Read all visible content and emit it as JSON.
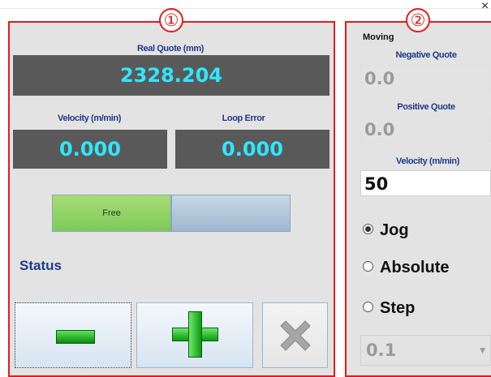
{
  "window": {
    "close_glyph": "×"
  },
  "panel1": {
    "badge": "①",
    "real_quote": {
      "label": "Real Quote (mm)",
      "value": "2328.204"
    },
    "velocity": {
      "label": "Velocity (m/min)",
      "value": "0.000"
    },
    "loop_error": {
      "label": "Loop Error",
      "value": "0.000"
    },
    "mode_toggle": {
      "active_label": "Free",
      "inactive_label": ""
    },
    "status_label": "Status",
    "buttons": {
      "minus": "minus-icon",
      "plus": "plus-icon",
      "stop": "x-icon"
    }
  },
  "panel2": {
    "badge": "②",
    "title": "Moving",
    "negative_quote": {
      "label": "Negative Quote",
      "value": "0.0"
    },
    "positive_quote": {
      "label": "Positive Quote",
      "value": "0.0"
    },
    "velocity": {
      "label": "Velocity (m/min)",
      "value": "50"
    },
    "mode": {
      "options": [
        "Jog",
        "Absolute",
        "Step"
      ],
      "selected": "Jog"
    },
    "step_select": {
      "value": "0.1"
    }
  },
  "colors": {
    "accent_red": "#e41b1b",
    "display_bg": "#595959",
    "display_text": "#2fe6ff",
    "label_blue": "#1f3a8a",
    "toggle_green": "#8ed163"
  }
}
